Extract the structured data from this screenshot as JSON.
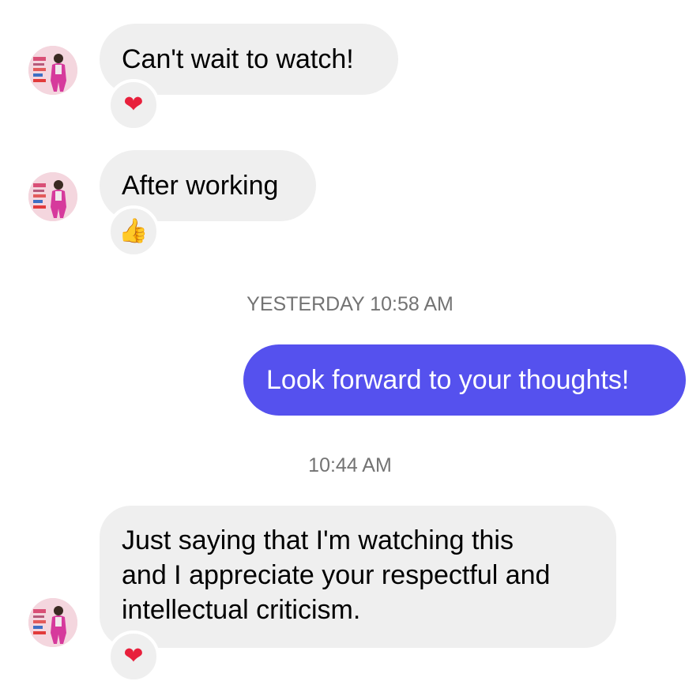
{
  "messages": [
    {
      "id": "m1",
      "direction": "incoming",
      "text": "Can't wait to watch!",
      "reaction": {
        "emoji": "❤",
        "icon": "heart-icon"
      }
    },
    {
      "id": "m2",
      "direction": "incoming",
      "text": "After working",
      "reaction": {
        "emoji": "👍",
        "icon": "thumbs-up-icon"
      }
    },
    {
      "id": "m3",
      "direction": "outgoing",
      "text": "Look forward to your thoughts!"
    },
    {
      "id": "m4",
      "direction": "incoming",
      "lines": [
        "Just saying that I'm watching this",
        "and I appreciate your respectful and",
        "intellectual criticism."
      ],
      "reaction": {
        "emoji": "❤",
        "icon": "heart-icon"
      }
    }
  ],
  "timestamps": {
    "first": "YESTERDAY 10:58 AM",
    "second": "10:44 AM"
  },
  "colors": {
    "incoming_bubble": "#efefef",
    "outgoing_bubble": "#5551ee",
    "timestamp_text": "#737373",
    "heart": "#e8203c"
  }
}
